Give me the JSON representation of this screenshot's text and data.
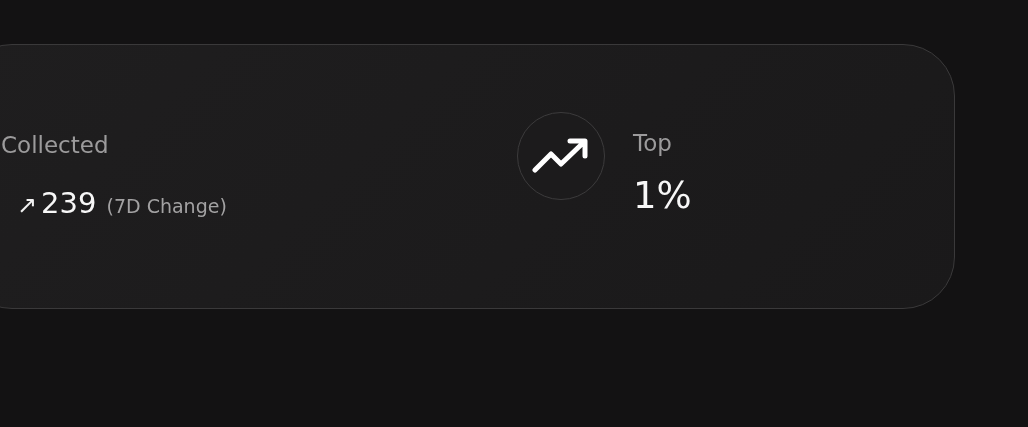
{
  "stats": [
    {
      "kind": "change",
      "label": "Collected",
      "arrow": "↗",
      "value": "239",
      "note": "(7D Change)"
    },
    {
      "kind": "rank",
      "label": "Top",
      "value": "1%"
    }
  ]
}
